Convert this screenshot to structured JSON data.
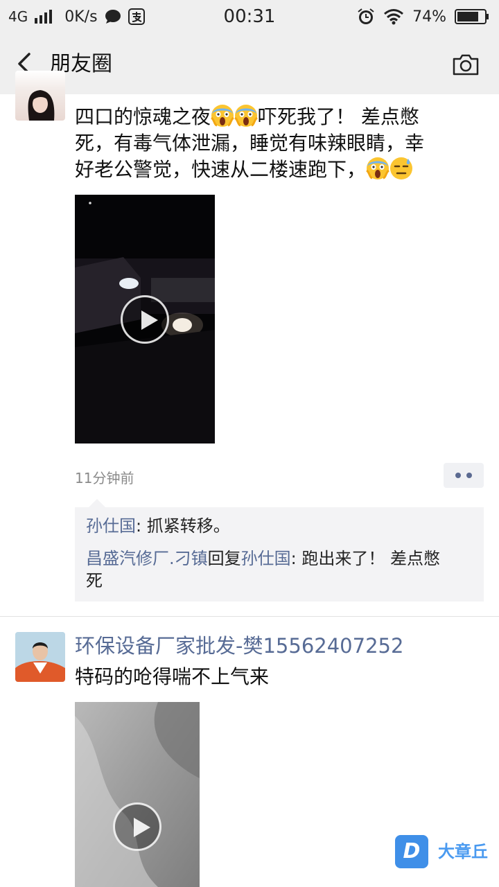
{
  "status_bar": {
    "network": "4G",
    "speed": "0K/s",
    "time": "00:31",
    "battery": "74%"
  },
  "nav": {
    "title": "朋友圈",
    "back_icon": "back-arrow-icon",
    "camera_icon": "camera-icon"
  },
  "posts": [
    {
      "text_lines": [
        "四口的惊魂之夜",
        "吓死我了！ 差点憋",
        "死，有毒气体泄漏，睡觉有味辣眼睛，幸",
        "好老公警觉，快速从二楼速跑下，"
      ],
      "time": "11分钟前",
      "comments": [
        {
          "name": "孙仕国",
          "sep": ": ",
          "text": "抓紧转移。"
        },
        {
          "name": "昌盛汽修厂.刁镇",
          "reply_word": "回复",
          "reply_to": "孙仕国",
          "sep": ": ",
          "text_line1": "跑出来了！ 差点憋",
          "text_line2": "死"
        }
      ]
    },
    {
      "author": "环保设备厂家批发-樊15562407252",
      "text": "特码的呛得喘不上气来"
    }
  ],
  "watermark": {
    "logo_letter": "D",
    "text": "大章丘"
  },
  "colors": {
    "link": "#576b95",
    "bar_bg": "#efefef",
    "comment_bg": "#f3f3f5"
  }
}
